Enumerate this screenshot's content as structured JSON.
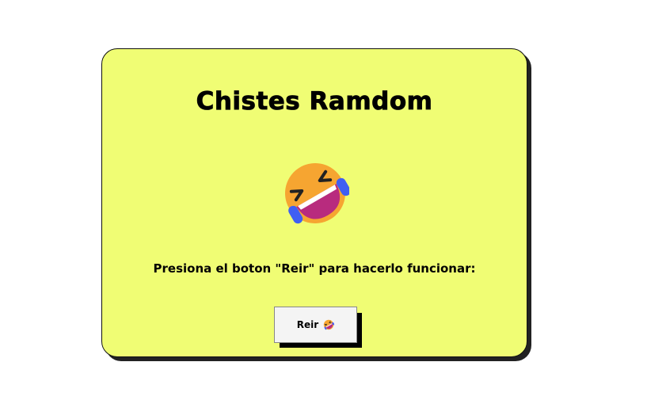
{
  "app": {
    "title": "Chistes Ramdom",
    "instruction": "Presiona el boton \"Reir\" para hacerlo funcionar:",
    "button_label": "Reir",
    "main_icon": "rolling-on-floor-laughing-icon",
    "button_icon": "rolling-on-floor-laughing-icon"
  },
  "colors": {
    "card_background": "#f0fd74",
    "emoji_face": "#f6a531",
    "emoji_mouth": "#b82b7e",
    "emoji_hands": "#3f5ff3",
    "button_background": "#f4f4f4"
  }
}
